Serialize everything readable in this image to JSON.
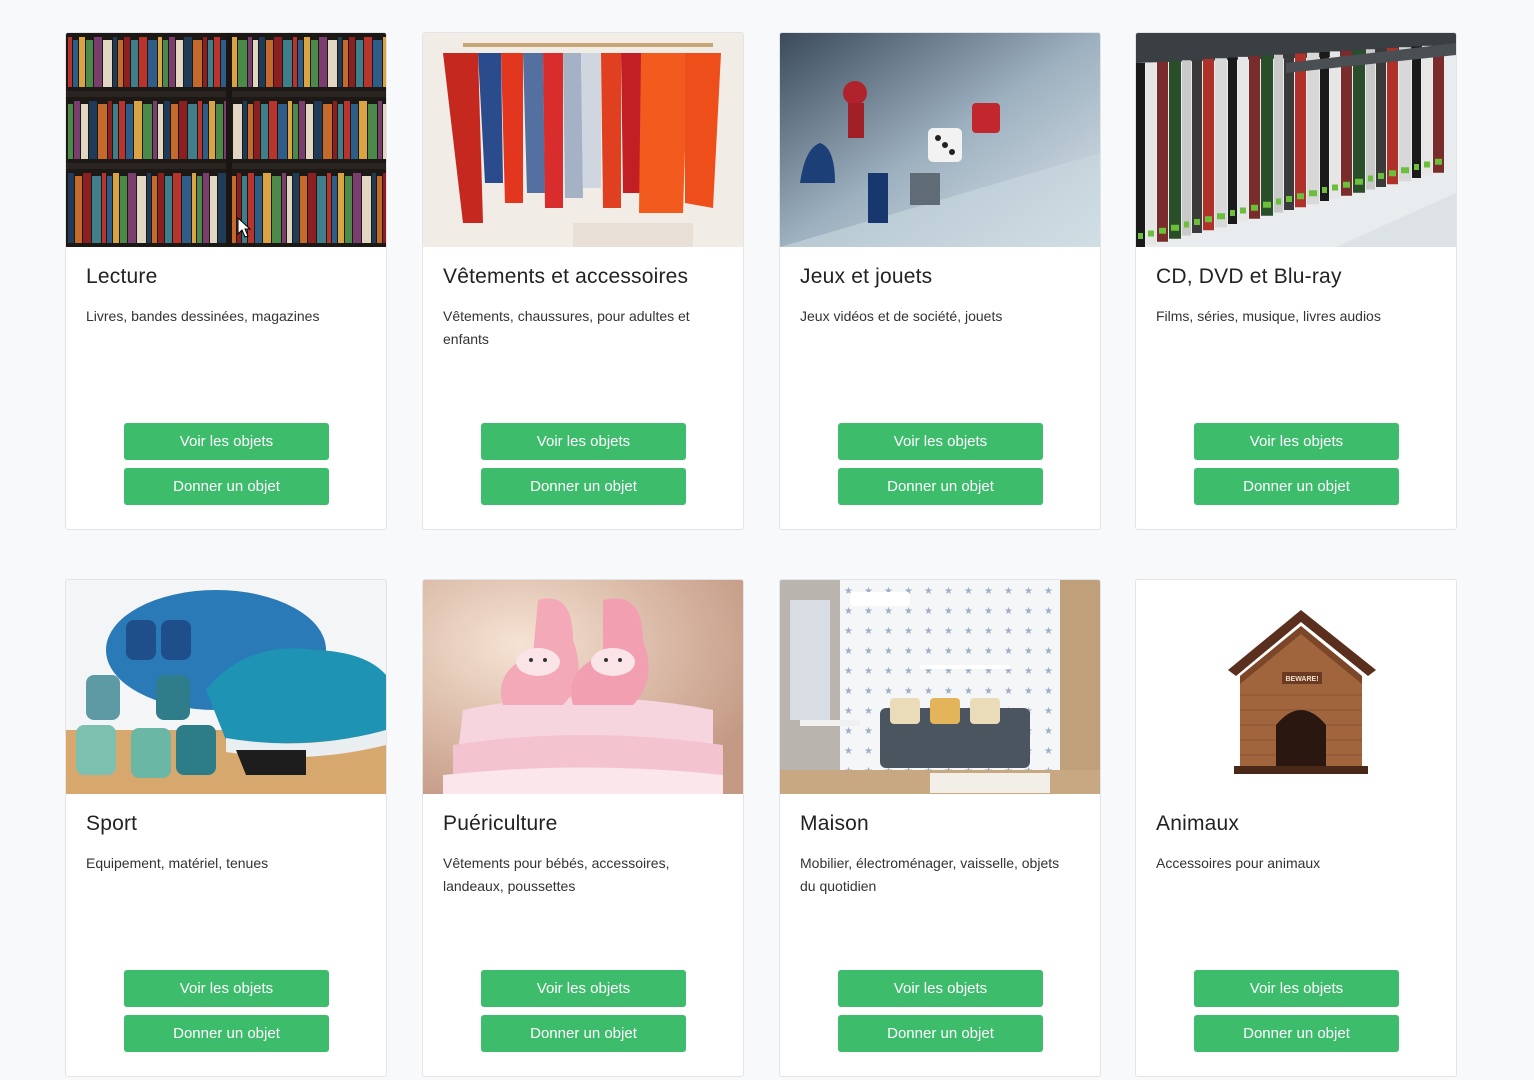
{
  "categories": [
    {
      "title": "Lecture",
      "description": "Livres, bandes dessinées, magazines",
      "image": "bookshelf-photo",
      "see_label": "Voir les objets",
      "give_label": "Donner un objet"
    },
    {
      "title": "Vêtements et accessoires",
      "description": "Vêtements, chaussures, pour adultes et enfants",
      "image": "clothes-rack-photo",
      "see_label": "Voir les objets",
      "give_label": "Donner un objet"
    },
    {
      "title": "Jeux et jouets",
      "description": "Jeux vidéos et de société, jouets",
      "image": "board-game-photo",
      "see_label": "Voir les objets",
      "give_label": "Donner un objet"
    },
    {
      "title": "CD, DVD et Blu-ray",
      "description": "Films, séries, musique, livres audios",
      "image": "dvd-shelf-photo",
      "see_label": "Voir les objets",
      "give_label": "Donner un objet"
    },
    {
      "title": "Sport",
      "description": "Equipement, matériel, tenues",
      "image": "dumbbells-sneaker-photo",
      "see_label": "Voir les objets",
      "give_label": "Donner un objet"
    },
    {
      "title": "Puériculture",
      "description": "Vêtements pour bébés, accessoires, landeaux, poussettes",
      "image": "baby-booties-photo",
      "see_label": "Voir les objets",
      "give_label": "Donner un objet"
    },
    {
      "title": "Maison",
      "description": "Mobilier, électroménager, vaisselle, objets du quotidien",
      "image": "living-room-photo",
      "see_label": "Voir les objets",
      "give_label": "Donner un objet"
    },
    {
      "title": "Animaux",
      "description": "Accessoires pour animaux",
      "image": "dog-house-photo",
      "image_text": "BEWARE!",
      "see_label": "Voir les objets",
      "give_label": "Donner un objet"
    }
  ],
  "colors": {
    "button_bg": "#3dbd6c",
    "page_bg": "#f8f9fb",
    "card_border": "#e2e4e8"
  }
}
